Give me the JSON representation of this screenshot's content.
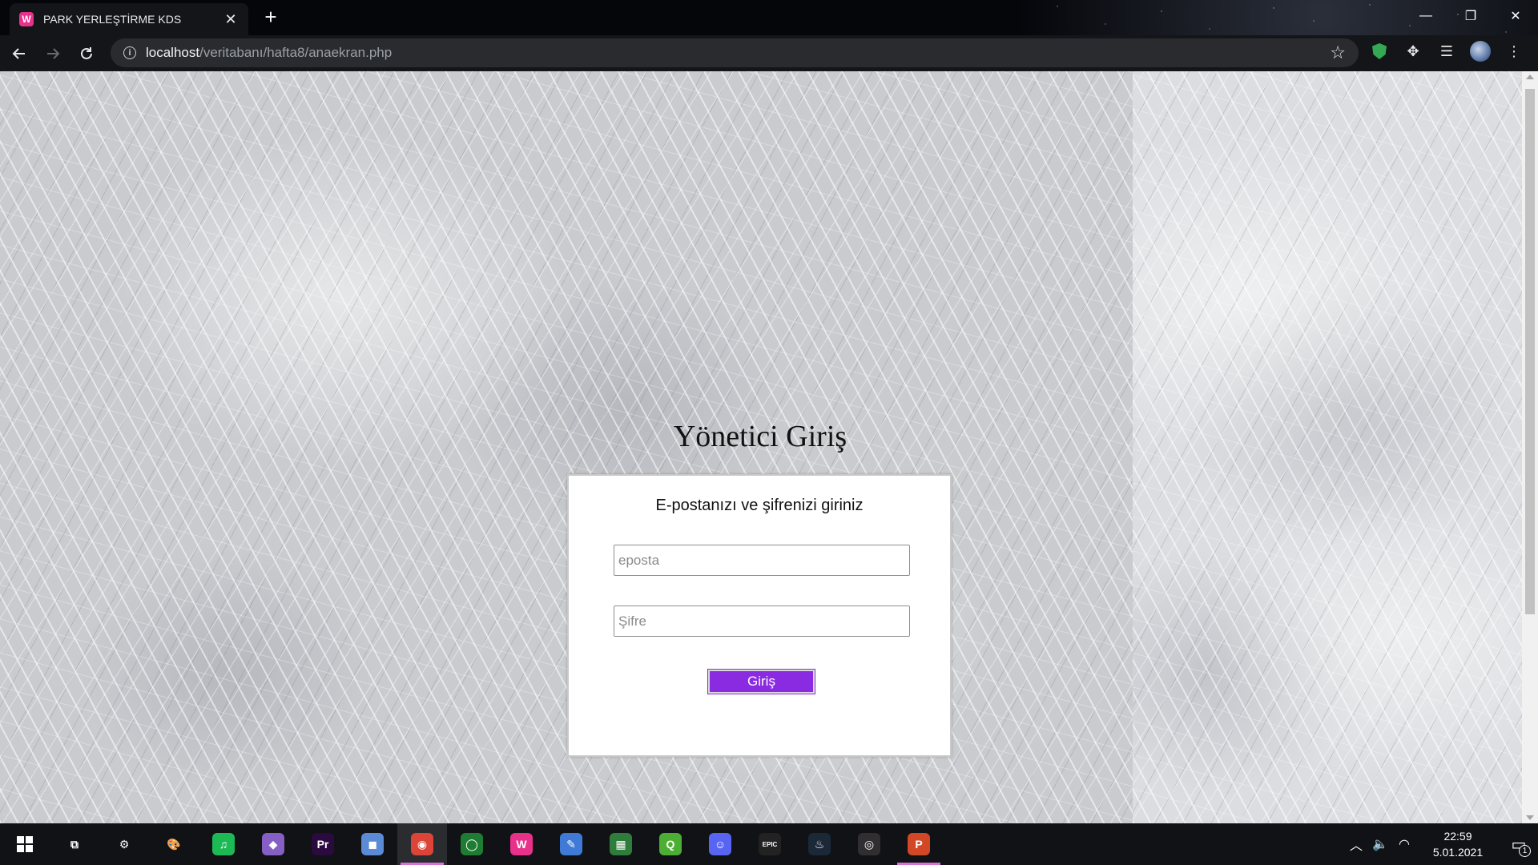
{
  "browser": {
    "tab_title": "PARK YERLEŞTİRME KDS",
    "tab_close": "✕",
    "new_tab": "+",
    "url_host": "localhost",
    "url_path": "/veritabanı/hafta8/anaekran.php",
    "window_controls": {
      "minimize": "—",
      "restore": "❐",
      "close": "✕"
    }
  },
  "page": {
    "title": "Yönetici Giriş",
    "card_subtitle": "E-postanızı ve şifrenizi giriniz",
    "email_placeholder": "eposta",
    "password_placeholder": "Şifre",
    "submit_label": "Giriş",
    "button_color": "#8a2be2"
  },
  "taskbar": {
    "apps": [
      {
        "name": "task-view",
        "glyph": "⧉",
        "color": "transparent"
      },
      {
        "name": "steelseries",
        "glyph": "⚙",
        "color": "transparent"
      },
      {
        "name": "paint",
        "glyph": "🎨",
        "color": "transparent"
      },
      {
        "name": "spotify",
        "glyph": "♫",
        "color": "#1db954"
      },
      {
        "name": "visual-studio",
        "glyph": "◆",
        "color": "#865fc5"
      },
      {
        "name": "premiere-pro",
        "glyph": "Pr",
        "color": "#2a0a3f"
      },
      {
        "name": "3d-viewer",
        "glyph": "◼",
        "color": "#5b8bd6"
      },
      {
        "name": "chrome",
        "glyph": "◉",
        "color": "#db4437"
      },
      {
        "name": "greenshot",
        "glyph": "◯",
        "color": "#1e7d32"
      },
      {
        "name": "wampserver",
        "glyph": "W",
        "color": "#e8318a"
      },
      {
        "name": "notepad",
        "glyph": "✎",
        "color": "#3f7bd6"
      },
      {
        "name": "excel-file",
        "glyph": "▦",
        "color": "#2f7d3c"
      },
      {
        "name": "qlik",
        "glyph": "Q",
        "color": "#4cae33"
      },
      {
        "name": "discord",
        "glyph": "☺",
        "color": "#5865f2"
      },
      {
        "name": "epic-games",
        "glyph": "EPIC",
        "color": "#222"
      },
      {
        "name": "steam",
        "glyph": "♨",
        "color": "#1b2838"
      },
      {
        "name": "obs",
        "glyph": "◎",
        "color": "#302e31"
      },
      {
        "name": "powerpoint",
        "glyph": "P",
        "color": "#d24726"
      }
    ],
    "time": "22:59",
    "date": "5.01.2021",
    "notification_count": "1"
  }
}
